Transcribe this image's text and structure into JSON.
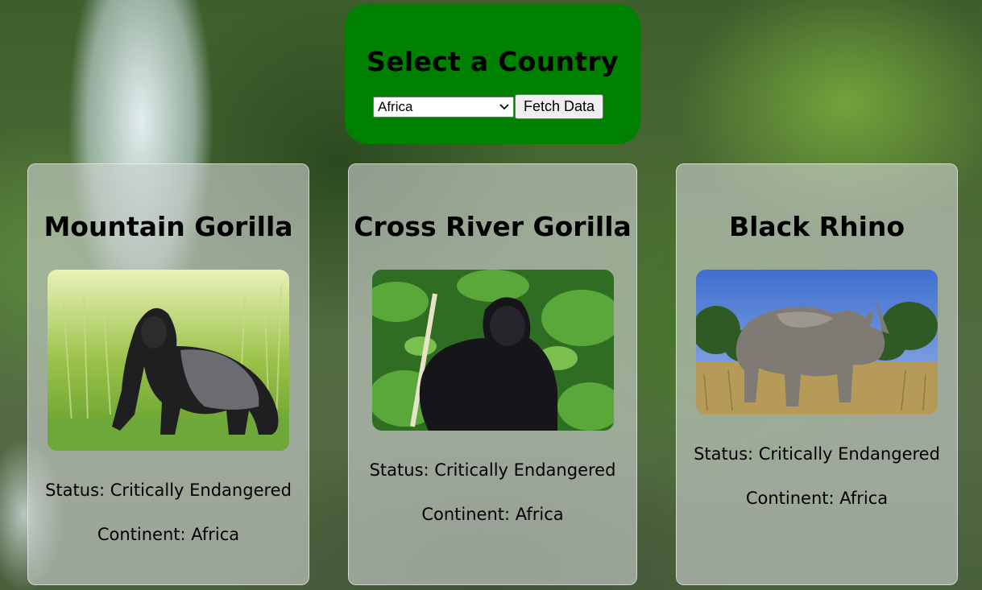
{
  "header": {
    "title": "Select a Country",
    "select_value": "Africa",
    "fetch_label": "Fetch Data"
  },
  "cards": [
    {
      "name": "Mountain Gorilla",
      "status": "Status: Critically Endangered",
      "continent": "Continent: Africa",
      "image": "mountain-gorilla-photo"
    },
    {
      "name": "Cross River Gorilla",
      "status": "Status: Critically Endangered",
      "continent": "Continent: Africa",
      "image": "cross-river-gorilla-photo"
    },
    {
      "name": "Black Rhino",
      "status": "Status: Critically Endangered",
      "continent": "Continent: Africa",
      "image": "black-rhino-photo"
    }
  ],
  "colors": {
    "panel": "#008000",
    "card": "rgba(205,208,208,0.62)"
  },
  "icons": {
    "select_chevron": "chevron-down-icon"
  }
}
